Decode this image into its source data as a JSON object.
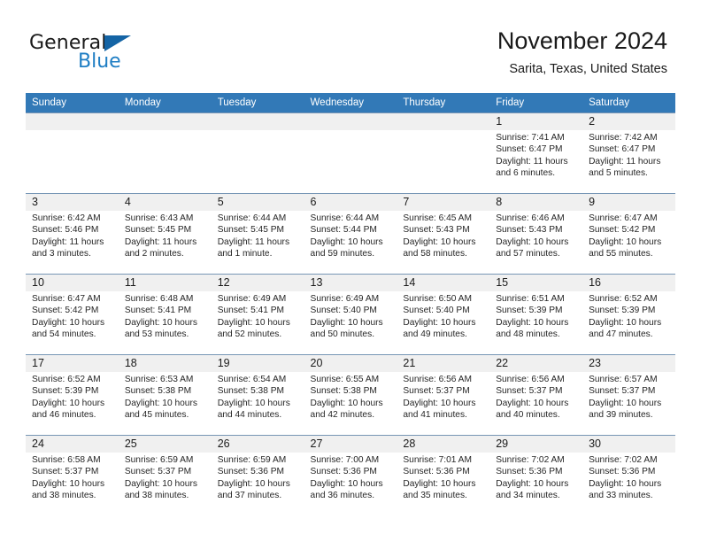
{
  "brand": {
    "word1": "General",
    "word2": "Blue",
    "flag_icon": "triangle-flag-icon",
    "accent_color": "#1464a5",
    "blue_text_color": "#1f7ec4"
  },
  "header": {
    "month_title": "November 2024",
    "location": "Sarita, Texas, United States",
    "header_bg_color": "#3279b7",
    "daynum_bg_color": "#f0f0f0"
  },
  "weekday_headers": [
    "Sunday",
    "Monday",
    "Tuesday",
    "Wednesday",
    "Thursday",
    "Friday",
    "Saturday"
  ],
  "weeks": [
    [
      {
        "day": "",
        "sunrise": "",
        "sunset": "",
        "daylight_line1": "",
        "daylight_line2": ""
      },
      {
        "day": "",
        "sunrise": "",
        "sunset": "",
        "daylight_line1": "",
        "daylight_line2": ""
      },
      {
        "day": "",
        "sunrise": "",
        "sunset": "",
        "daylight_line1": "",
        "daylight_line2": ""
      },
      {
        "day": "",
        "sunrise": "",
        "sunset": "",
        "daylight_line1": "",
        "daylight_line2": ""
      },
      {
        "day": "",
        "sunrise": "",
        "sunset": "",
        "daylight_line1": "",
        "daylight_line2": ""
      },
      {
        "day": "1",
        "sunrise": "Sunrise: 7:41 AM",
        "sunset": "Sunset: 6:47 PM",
        "daylight_line1": "Daylight: 11 hours",
        "daylight_line2": "and 6 minutes."
      },
      {
        "day": "2",
        "sunrise": "Sunrise: 7:42 AM",
        "sunset": "Sunset: 6:47 PM",
        "daylight_line1": "Daylight: 11 hours",
        "daylight_line2": "and 5 minutes."
      }
    ],
    [
      {
        "day": "3",
        "sunrise": "Sunrise: 6:42 AM",
        "sunset": "Sunset: 5:46 PM",
        "daylight_line1": "Daylight: 11 hours",
        "daylight_line2": "and 3 minutes."
      },
      {
        "day": "4",
        "sunrise": "Sunrise: 6:43 AM",
        "sunset": "Sunset: 5:45 PM",
        "daylight_line1": "Daylight: 11 hours",
        "daylight_line2": "and 2 minutes."
      },
      {
        "day": "5",
        "sunrise": "Sunrise: 6:44 AM",
        "sunset": "Sunset: 5:45 PM",
        "daylight_line1": "Daylight: 11 hours",
        "daylight_line2": "and 1 minute."
      },
      {
        "day": "6",
        "sunrise": "Sunrise: 6:44 AM",
        "sunset": "Sunset: 5:44 PM",
        "daylight_line1": "Daylight: 10 hours",
        "daylight_line2": "and 59 minutes."
      },
      {
        "day": "7",
        "sunrise": "Sunrise: 6:45 AM",
        "sunset": "Sunset: 5:43 PM",
        "daylight_line1": "Daylight: 10 hours",
        "daylight_line2": "and 58 minutes."
      },
      {
        "day": "8",
        "sunrise": "Sunrise: 6:46 AM",
        "sunset": "Sunset: 5:43 PM",
        "daylight_line1": "Daylight: 10 hours",
        "daylight_line2": "and 57 minutes."
      },
      {
        "day": "9",
        "sunrise": "Sunrise: 6:47 AM",
        "sunset": "Sunset: 5:42 PM",
        "daylight_line1": "Daylight: 10 hours",
        "daylight_line2": "and 55 minutes."
      }
    ],
    [
      {
        "day": "10",
        "sunrise": "Sunrise: 6:47 AM",
        "sunset": "Sunset: 5:42 PM",
        "daylight_line1": "Daylight: 10 hours",
        "daylight_line2": "and 54 minutes."
      },
      {
        "day": "11",
        "sunrise": "Sunrise: 6:48 AM",
        "sunset": "Sunset: 5:41 PM",
        "daylight_line1": "Daylight: 10 hours",
        "daylight_line2": "and 53 minutes."
      },
      {
        "day": "12",
        "sunrise": "Sunrise: 6:49 AM",
        "sunset": "Sunset: 5:41 PM",
        "daylight_line1": "Daylight: 10 hours",
        "daylight_line2": "and 52 minutes."
      },
      {
        "day": "13",
        "sunrise": "Sunrise: 6:49 AM",
        "sunset": "Sunset: 5:40 PM",
        "daylight_line1": "Daylight: 10 hours",
        "daylight_line2": "and 50 minutes."
      },
      {
        "day": "14",
        "sunrise": "Sunrise: 6:50 AM",
        "sunset": "Sunset: 5:40 PM",
        "daylight_line1": "Daylight: 10 hours",
        "daylight_line2": "and 49 minutes."
      },
      {
        "day": "15",
        "sunrise": "Sunrise: 6:51 AM",
        "sunset": "Sunset: 5:39 PM",
        "daylight_line1": "Daylight: 10 hours",
        "daylight_line2": "and 48 minutes."
      },
      {
        "day": "16",
        "sunrise": "Sunrise: 6:52 AM",
        "sunset": "Sunset: 5:39 PM",
        "daylight_line1": "Daylight: 10 hours",
        "daylight_line2": "and 47 minutes."
      }
    ],
    [
      {
        "day": "17",
        "sunrise": "Sunrise: 6:52 AM",
        "sunset": "Sunset: 5:39 PM",
        "daylight_line1": "Daylight: 10 hours",
        "daylight_line2": "and 46 minutes."
      },
      {
        "day": "18",
        "sunrise": "Sunrise: 6:53 AM",
        "sunset": "Sunset: 5:38 PM",
        "daylight_line1": "Daylight: 10 hours",
        "daylight_line2": "and 45 minutes."
      },
      {
        "day": "19",
        "sunrise": "Sunrise: 6:54 AM",
        "sunset": "Sunset: 5:38 PM",
        "daylight_line1": "Daylight: 10 hours",
        "daylight_line2": "and 44 minutes."
      },
      {
        "day": "20",
        "sunrise": "Sunrise: 6:55 AM",
        "sunset": "Sunset: 5:38 PM",
        "daylight_line1": "Daylight: 10 hours",
        "daylight_line2": "and 42 minutes."
      },
      {
        "day": "21",
        "sunrise": "Sunrise: 6:56 AM",
        "sunset": "Sunset: 5:37 PM",
        "daylight_line1": "Daylight: 10 hours",
        "daylight_line2": "and 41 minutes."
      },
      {
        "day": "22",
        "sunrise": "Sunrise: 6:56 AM",
        "sunset": "Sunset: 5:37 PM",
        "daylight_line1": "Daylight: 10 hours",
        "daylight_line2": "and 40 minutes."
      },
      {
        "day": "23",
        "sunrise": "Sunrise: 6:57 AM",
        "sunset": "Sunset: 5:37 PM",
        "daylight_line1": "Daylight: 10 hours",
        "daylight_line2": "and 39 minutes."
      }
    ],
    [
      {
        "day": "24",
        "sunrise": "Sunrise: 6:58 AM",
        "sunset": "Sunset: 5:37 PM",
        "daylight_line1": "Daylight: 10 hours",
        "daylight_line2": "and 38 minutes."
      },
      {
        "day": "25",
        "sunrise": "Sunrise: 6:59 AM",
        "sunset": "Sunset: 5:37 PM",
        "daylight_line1": "Daylight: 10 hours",
        "daylight_line2": "and 38 minutes."
      },
      {
        "day": "26",
        "sunrise": "Sunrise: 6:59 AM",
        "sunset": "Sunset: 5:36 PM",
        "daylight_line1": "Daylight: 10 hours",
        "daylight_line2": "and 37 minutes."
      },
      {
        "day": "27",
        "sunrise": "Sunrise: 7:00 AM",
        "sunset": "Sunset: 5:36 PM",
        "daylight_line1": "Daylight: 10 hours",
        "daylight_line2": "and 36 minutes."
      },
      {
        "day": "28",
        "sunrise": "Sunrise: 7:01 AM",
        "sunset": "Sunset: 5:36 PM",
        "daylight_line1": "Daylight: 10 hours",
        "daylight_line2": "and 35 minutes."
      },
      {
        "day": "29",
        "sunrise": "Sunrise: 7:02 AM",
        "sunset": "Sunset: 5:36 PM",
        "daylight_line1": "Daylight: 10 hours",
        "daylight_line2": "and 34 minutes."
      },
      {
        "day": "30",
        "sunrise": "Sunrise: 7:02 AM",
        "sunset": "Sunset: 5:36 PM",
        "daylight_line1": "Daylight: 10 hours",
        "daylight_line2": "and 33 minutes."
      }
    ]
  ]
}
